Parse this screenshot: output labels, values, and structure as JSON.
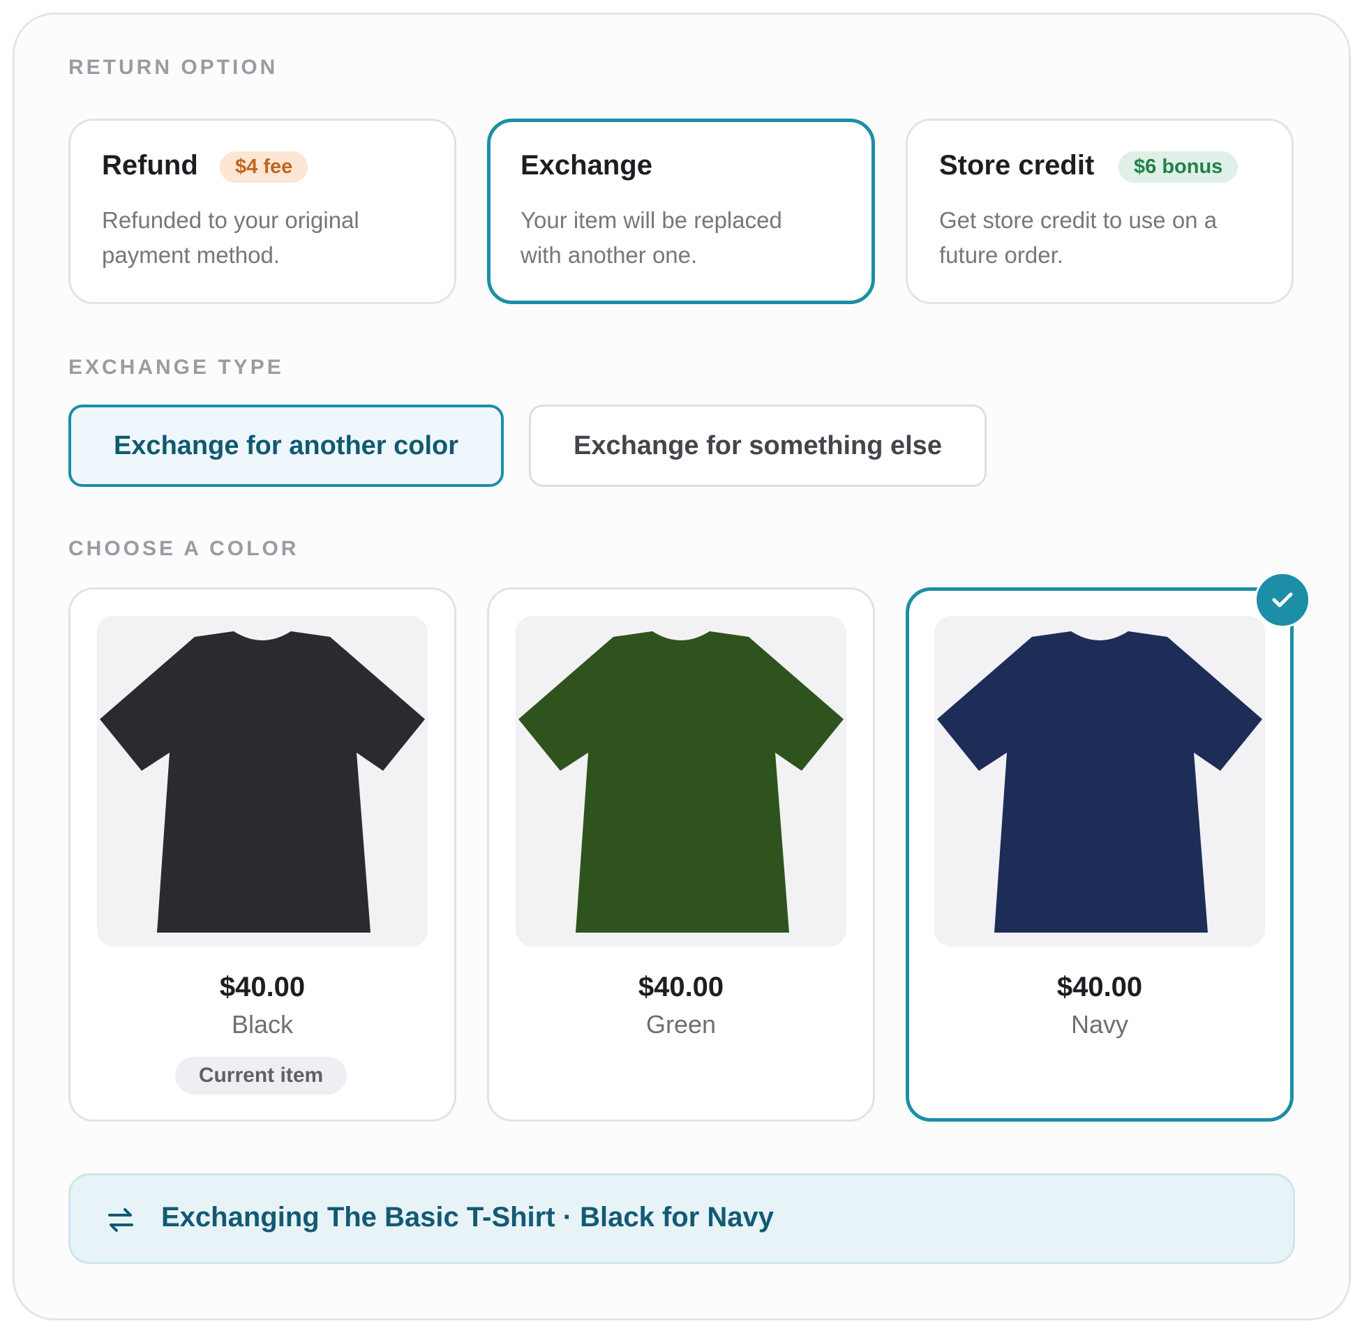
{
  "sections": {
    "return_option": "RETURN OPTION",
    "exchange_type": "EXCHANGE TYPE",
    "choose_color": "CHOOSE A COLOR"
  },
  "return_options": [
    {
      "title": "Refund",
      "badge": "$4 fee",
      "description": "Refunded to your original payment method.",
      "selected": false
    },
    {
      "title": "Exchange",
      "badge": "",
      "description": "Your item will be replaced with another one.",
      "selected": true
    },
    {
      "title": "Store credit",
      "badge": "$6 bonus",
      "description": "Get store credit to use on a future order.",
      "selected": false
    }
  ],
  "exchange_types": [
    {
      "label": "Exchange for another color",
      "selected": true
    },
    {
      "label": "Exchange for something else",
      "selected": false
    }
  ],
  "colors": [
    {
      "price": "$40.00",
      "name": "Black",
      "tag": "Current item",
      "selected": false,
      "swatch": "#2b2b2f",
      "icon": "t-shirt-black-image"
    },
    {
      "price": "$40.00",
      "name": "Green",
      "tag": "",
      "selected": false,
      "swatch": "#2e531c",
      "icon": "t-shirt-green-image"
    },
    {
      "price": "$40.00",
      "name": "Navy",
      "tag": "",
      "selected": true,
      "swatch": "#1d2d57",
      "icon": "t-shirt-navy-image"
    }
  ],
  "summary": {
    "icon": "swap-arrows-icon",
    "text": "Exchanging The Basic T-Shirt · Black for Navy"
  },
  "theme": {
    "accent": "#1c8ea5",
    "fee_bg": "#fde6d3",
    "bonus_bg": "#dff0e6"
  }
}
